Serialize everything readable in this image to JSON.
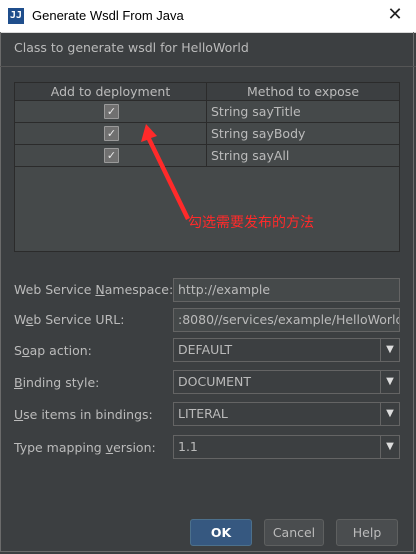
{
  "window": {
    "title": "Generate Wsdl From Java",
    "app_icon_text": "JJ",
    "close_glyph": "✕"
  },
  "subtitle": "Class to generate wsdl for HelloWorld",
  "table": {
    "headers": [
      "Add to deployment",
      "Method to expose"
    ],
    "rows": [
      {
        "checked": true,
        "method": "String sayTitle"
      },
      {
        "checked": true,
        "method": "String sayBody"
      },
      {
        "checked": true,
        "method": "String sayAll"
      }
    ]
  },
  "annotation": {
    "text": "勾选需要发布的方法",
    "color": "#ff2a2a"
  },
  "form": {
    "namespace": {
      "label_pre": "Web Service ",
      "label_u": "N",
      "label_post": "amespace:",
      "value": "http://example"
    },
    "url": {
      "label_pre": "W",
      "label_u": "e",
      "label_post": "b Service URL:",
      "value": ":8080//services/example/HelloWorld"
    },
    "soap_action": {
      "label_pre": "S",
      "label_u": "o",
      "label_post": "ap action:",
      "value": "DEFAULT"
    },
    "binding_style": {
      "label_pre": "",
      "label_u": "B",
      "label_post": "inding style:",
      "value": "DOCUMENT"
    },
    "use_items": {
      "label_pre": "",
      "label_u": "U",
      "label_post": "se items in bindings:",
      "value": "LITERAL"
    },
    "type_mapping": {
      "label_pre": "Type mapping ",
      "label_u": "v",
      "label_post": "ersion:",
      "value": "1.1"
    }
  },
  "buttons": {
    "ok": "OK",
    "cancel": "Cancel",
    "help": "Help"
  },
  "colors": {
    "background": "#3c3f41",
    "text": "#bbbbbb",
    "ok_button": "#365880"
  }
}
